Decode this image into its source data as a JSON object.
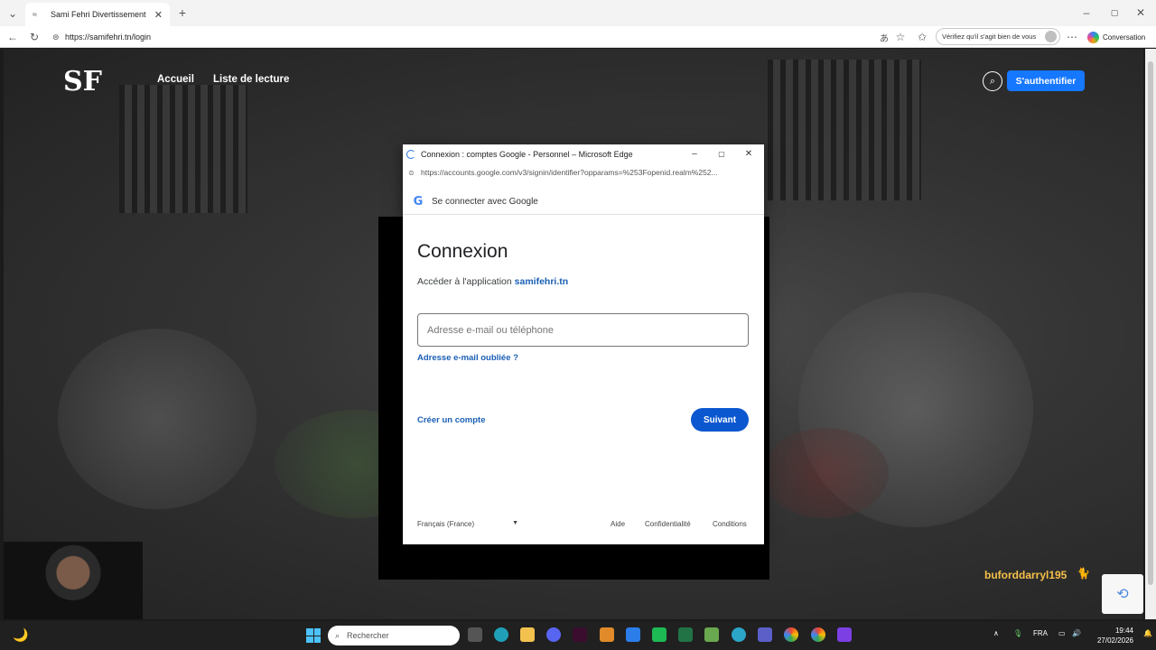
{
  "browser": {
    "tab_title": "Sami Fehri Divertissement",
    "tab_close": "✕",
    "new_tab": "+",
    "url": "https://samifehri.tn/login",
    "verify_prompt": "Vérifiez qu'il s'agit bien de vous",
    "conversation_label": "Conversation"
  },
  "site": {
    "logo_text": "SF",
    "nav": [
      "Accueil",
      "Liste de lecture"
    ],
    "auth_button": "S'authentifier",
    "username": "buforddarryl195"
  },
  "popup": {
    "title": "Connexion : comptes Google - Personnel – Microsoft Edge",
    "url": "https://accounts.google.com/v3/signin/identifier?opparams=%253Fopenid.realm%252...",
    "header": "Se connecter avec Google",
    "heading": "Connexion",
    "subtitle_prefix": "Accéder à l'application",
    "app_name": "samifehri.tn",
    "email_placeholder": "Adresse e-mail ou téléphone",
    "forgot_email": "Adresse e-mail oubliée ?",
    "create_account": "Créer un compte",
    "next_button": "Suivant",
    "language": "Français (France)",
    "footer_links": [
      "Aide",
      "Confidentialité",
      "Conditions"
    ]
  },
  "taskbar": {
    "search_placeholder": "Rechercher",
    "language": "FRA",
    "time": "19:44",
    "date": "27/02/2026"
  },
  "colors": {
    "accent_site": "#1677ff",
    "google_blue": "#0b57d0",
    "username": "#f5c04a"
  }
}
